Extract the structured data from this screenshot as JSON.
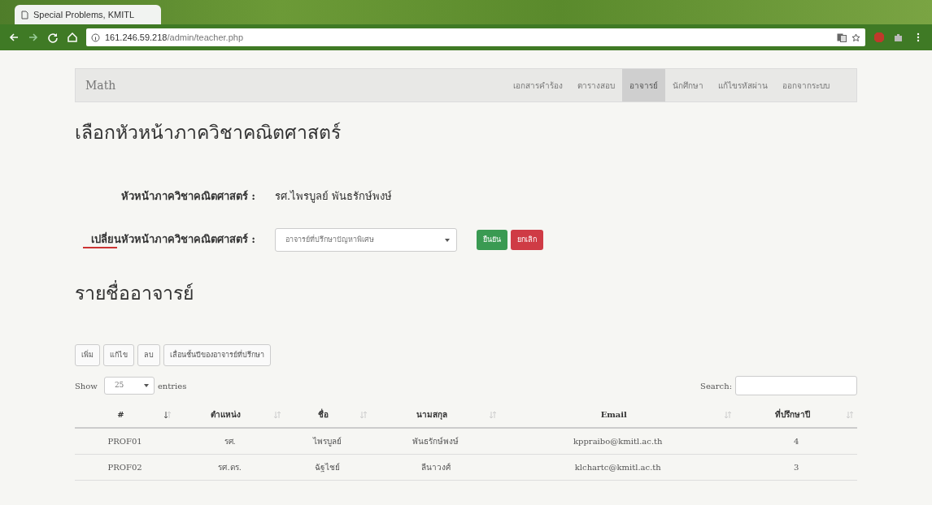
{
  "browser": {
    "tab_title": "Special Problems, KMITL",
    "url_host": "161.246.59.218",
    "url_path": "/admin/teacher.php"
  },
  "navbar": {
    "brand": "Math",
    "items": [
      {
        "label": "เอกสารคำร้อง",
        "selected": false
      },
      {
        "label": "ตารางสอบ",
        "selected": false
      },
      {
        "label": "อาจารย์",
        "selected": true
      },
      {
        "label": "นักศึกษา",
        "selected": false
      },
      {
        "label": "แก้ไขรหัสผ่าน",
        "selected": false
      },
      {
        "label": "ออกจากระบบ",
        "selected": false
      }
    ]
  },
  "head_section": {
    "title": "เลือกหัวหน้าภาควิชาคณิตศาสตร์",
    "current_label": "หัวหน้าภาควิชาคณิตศาสตร์ :",
    "current_value": "รศ.ไพรบูลย์ พันธรักษ์พงษ์",
    "change_label": "เปลี่ยนหัวหน้าภาควิชาคณิตศาสตร์ :",
    "select_value": "อาจารย์ที่ปรึกษาปัญหาพิเศษ",
    "confirm": "ยืนยัน",
    "cancel": "ยกเลิก"
  },
  "teachers": {
    "title": "รายชื่ออาจารย์",
    "buttons": [
      "เพิ่ม",
      "แก้ไข",
      "ลบ",
      "เลื่อนชั้นปีของอาจารย์ที่ปรึกษา"
    ],
    "show_label": "Show",
    "page_size": "25",
    "entries_label": "entries",
    "search_label": "Search:",
    "columns": [
      {
        "label": "#",
        "sorted": true
      },
      {
        "label": "ตำแหน่ง",
        "sorted": false
      },
      {
        "label": "ชื่อ",
        "sorted": false
      },
      {
        "label": "นามสกุล",
        "sorted": false
      },
      {
        "label": "Email",
        "sorted": false
      },
      {
        "label": "ที่ปรึกษาปี",
        "sorted": false
      }
    ],
    "rows": [
      [
        "PROF01",
        "รศ.",
        "ไพรบูลย์",
        "พันธรักษ์พงษ์",
        "kppraibo@kmitl.ac.th",
        "4"
      ],
      [
        "PROF02",
        "รศ.ดร.",
        "ฉัฐไชย์",
        "ลีนาวงศ์",
        "klchartc@kmitl.ac.th",
        "3"
      ]
    ]
  }
}
